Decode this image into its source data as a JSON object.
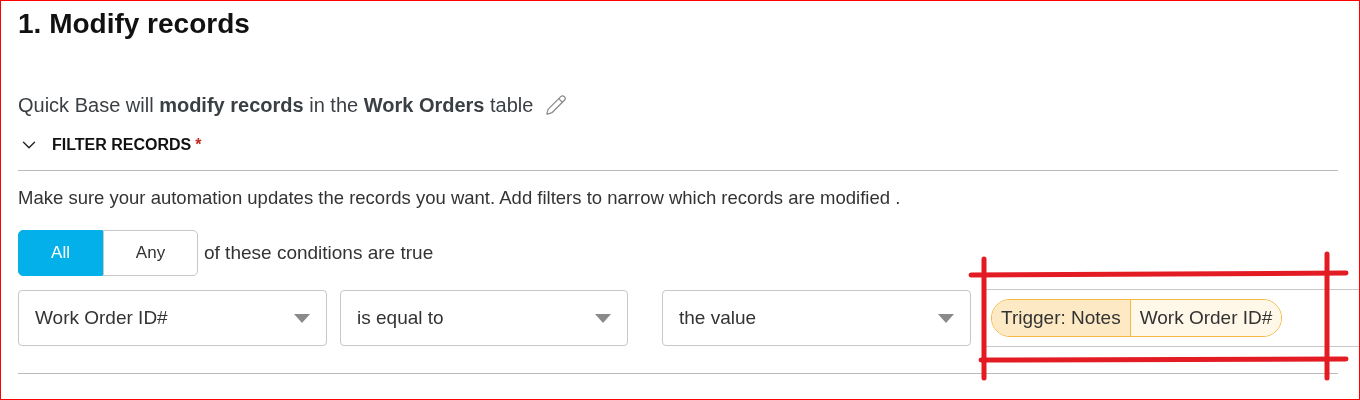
{
  "title": "1. Modify records",
  "summary": "Quick Base will **modify records** in the **Work Orders** table",
  "filter": {
    "label": "FILTER RECORDS",
    "required_mark": "*",
    "expanded": true
  },
  "help_text": "Make sure your automation updates the records you want. Add filters to narrow which records are modified .",
  "match_options": [
    {
      "label": "All",
      "selected": true
    },
    {
      "label": "Any",
      "selected": false
    }
  ],
  "match_suffix": "of these conditions are true",
  "condition": {
    "field": "Work Order ID#",
    "operator": "is equal to",
    "value_type": "the value",
    "value_token": {
      "source": "Trigger: Notes",
      "field": "Work Order ID#"
    }
  }
}
